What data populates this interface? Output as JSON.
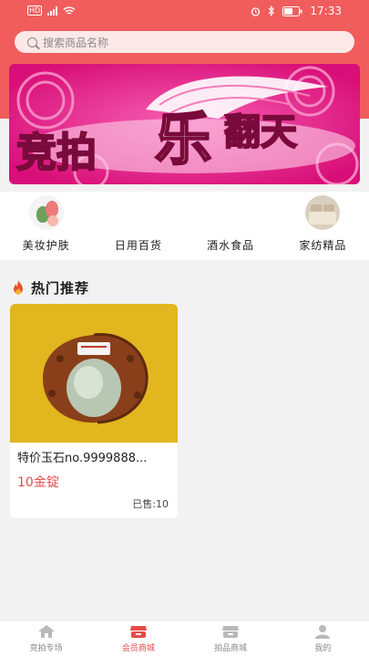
{
  "status_bar": {
    "left": "HD",
    "time": "17:33"
  },
  "search": {
    "placeholder": "搜索商品名称"
  },
  "banner": {
    "line1": "竞拍",
    "big": "乐",
    "line2": "翻天"
  },
  "categories": [
    {
      "label": "美妆护肤",
      "icon": "makeup-sponge-icon"
    },
    {
      "label": "日用百货",
      "icon": "daily-goods-icon"
    },
    {
      "label": "酒水食品",
      "icon": "food-drink-icon"
    },
    {
      "label": "家纺精品",
      "icon": "bedding-icon"
    }
  ],
  "hot": {
    "title": "热门推荐",
    "icon": "fire-icon"
  },
  "products": [
    {
      "name": "特价玉石no.9999888...",
      "price": "10金锭",
      "sold": "已售:10"
    }
  ],
  "tabbar": [
    {
      "label": "竞拍专场",
      "icon": "home-icon",
      "active": false
    },
    {
      "label": "会员商城",
      "icon": "store-icon",
      "active": true
    },
    {
      "label": "拍品商城",
      "icon": "shop-icon",
      "active": false
    },
    {
      "label": "我的",
      "icon": "user-icon",
      "active": false
    }
  ],
  "colors": {
    "header": "#f15d5d",
    "accent": "#e84b4b",
    "banner": "#e91a84"
  }
}
